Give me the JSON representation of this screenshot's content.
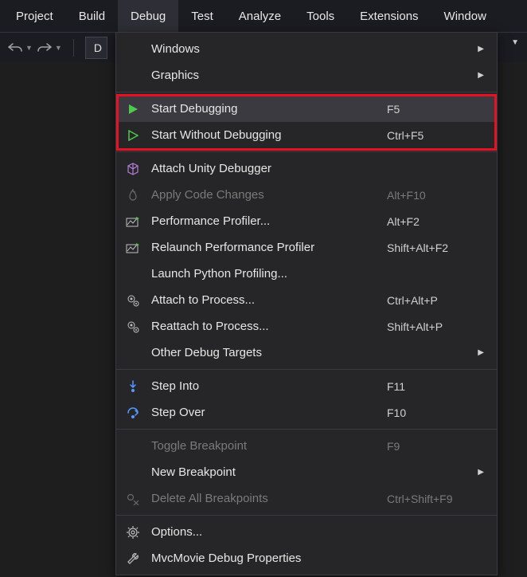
{
  "menubar": {
    "items": [
      {
        "label": "Project"
      },
      {
        "label": "Build"
      },
      {
        "label": "Debug",
        "active": true
      },
      {
        "label": "Test"
      },
      {
        "label": "Analyze"
      },
      {
        "label": "Tools"
      },
      {
        "label": "Extensions"
      },
      {
        "label": "Window"
      }
    ]
  },
  "toolbar": {
    "config_text": "D"
  },
  "menu": {
    "items": [
      {
        "icon": "",
        "label": "Windows",
        "shortcut": "",
        "submenu": true
      },
      {
        "icon": "",
        "label": "Graphics",
        "shortcut": "",
        "submenu": true
      },
      {
        "sep": true
      },
      {
        "icon": "play-filled",
        "label": "Start Debugging",
        "shortcut": "F5",
        "hovered": true
      },
      {
        "icon": "play-outline",
        "label": "Start Without Debugging",
        "shortcut": "Ctrl+F5"
      },
      {
        "sep": true
      },
      {
        "icon": "unity-cube",
        "label": "Attach Unity Debugger",
        "shortcut": ""
      },
      {
        "icon": "flame",
        "label": "Apply Code Changes",
        "shortcut": "Alt+F10",
        "disabled": true
      },
      {
        "icon": "perf-profiler",
        "label": "Performance Profiler...",
        "shortcut": "Alt+F2"
      },
      {
        "icon": "perf-relaunch",
        "label": "Relaunch Performance Profiler",
        "shortcut": "Shift+Alt+F2"
      },
      {
        "icon": "",
        "label": "Launch Python Profiling...",
        "shortcut": ""
      },
      {
        "icon": "gear-attach",
        "label": "Attach to Process...",
        "shortcut": "Ctrl+Alt+P"
      },
      {
        "icon": "gear-reattach",
        "label": "Reattach to Process...",
        "shortcut": "Shift+Alt+P"
      },
      {
        "icon": "",
        "label": "Other Debug Targets",
        "shortcut": "",
        "submenu": true
      },
      {
        "sep": true
      },
      {
        "icon": "step-into",
        "label": "Step Into",
        "shortcut": "F11"
      },
      {
        "icon": "step-over",
        "label": "Step Over",
        "shortcut": "F10"
      },
      {
        "sep": true
      },
      {
        "icon": "",
        "label": "Toggle Breakpoint",
        "shortcut": "F9",
        "disabled": true
      },
      {
        "icon": "",
        "label": "New Breakpoint",
        "shortcut": "",
        "submenu": true
      },
      {
        "icon": "delete-bp",
        "label": "Delete All Breakpoints",
        "shortcut": "Ctrl+Shift+F9",
        "disabled": true
      },
      {
        "sep": true
      },
      {
        "icon": "gear",
        "label": "Options...",
        "shortcut": ""
      },
      {
        "icon": "wrench",
        "label": "MvcMovie Debug Properties",
        "shortcut": ""
      }
    ]
  }
}
